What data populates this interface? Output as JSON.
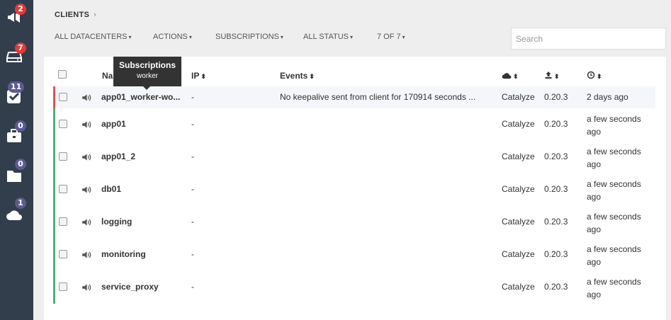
{
  "sidebar": {
    "items": [
      {
        "icon": "megaphone-icon",
        "badge": "2",
        "badge_color": "#e53935"
      },
      {
        "icon": "inbox-icon",
        "badge": "7",
        "badge_color": "#e53935"
      },
      {
        "icon": "check-square-icon",
        "badge": "11",
        "badge_color": "#5c5a93"
      },
      {
        "icon": "briefcase-icon",
        "badge": "0",
        "badge_color": "#5c5a93"
      },
      {
        "icon": "folder-icon",
        "badge": "0",
        "badge_color": "#5c5a93"
      },
      {
        "icon": "cloud-icon",
        "badge": "1",
        "badge_color": "#5c5a93"
      }
    ]
  },
  "breadcrumb": {
    "title": "CLIENTS",
    "chevron": "›"
  },
  "toolbar": {
    "datacenters": "ALL DATACENTERS",
    "actions": "ACTIONS",
    "subscriptions": "SUBSCRIPTIONS",
    "status": "ALL STATUS",
    "pagination": "7 OF 7",
    "caret": "▾"
  },
  "search": {
    "placeholder": "Search",
    "value": ""
  },
  "table": {
    "headers": {
      "name": "Name",
      "ip": "IP",
      "events": "Events",
      "sort": "⬍"
    },
    "rows": [
      {
        "name": "app01_worker-wo...",
        "ip": "-",
        "events": "No keepalive sent from client for 170914 seconds ...",
        "datacenter": "Catalyze",
        "version": "0.20.3",
        "last_seen_1": "2 days ago",
        "last_seen_2": "",
        "status_color": "#e05252"
      },
      {
        "name": "app01",
        "ip": "-",
        "events": "",
        "datacenter": "Catalyze",
        "version": "0.20.3",
        "last_seen_1": "a few seconds",
        "last_seen_2": "ago",
        "status_color": "#4caf7d"
      },
      {
        "name": "app01_2",
        "ip": "-",
        "events": "",
        "datacenter": "Catalyze",
        "version": "0.20.3",
        "last_seen_1": "a few seconds",
        "last_seen_2": "ago",
        "status_color": "#4caf7d"
      },
      {
        "name": "db01",
        "ip": "-",
        "events": "",
        "datacenter": "Catalyze",
        "version": "0.20.3",
        "last_seen_1": "a few seconds",
        "last_seen_2": "ago",
        "status_color": "#4caf7d"
      },
      {
        "name": "logging",
        "ip": "-",
        "events": "",
        "datacenter": "Catalyze",
        "version": "0.20.3",
        "last_seen_1": "a few seconds",
        "last_seen_2": "ago",
        "status_color": "#4caf7d"
      },
      {
        "name": "monitoring",
        "ip": "-",
        "events": "",
        "datacenter": "Catalyze",
        "version": "0.20.3",
        "last_seen_1": "a few seconds",
        "last_seen_2": "ago",
        "status_color": "#4caf7d"
      },
      {
        "name": "service_proxy",
        "ip": "-",
        "events": "",
        "datacenter": "Catalyze",
        "version": "0.20.3",
        "last_seen_1": "a few seconds",
        "last_seen_2": "ago",
        "status_color": "#4caf7d"
      }
    ]
  },
  "tooltip": {
    "title": "Subscriptions",
    "body": "worker"
  }
}
